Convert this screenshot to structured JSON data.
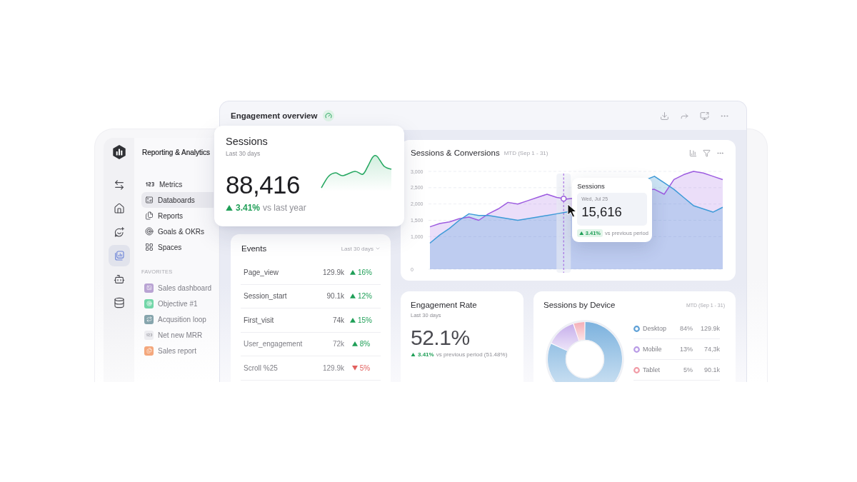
{
  "sidebar": {
    "rail": [
      {
        "kind": "swap",
        "selected": false
      },
      {
        "kind": "home",
        "selected": false
      },
      {
        "kind": "assistant",
        "selected": false
      },
      {
        "kind": "databoards",
        "selected": true
      },
      {
        "kind": "bot",
        "selected": false
      },
      {
        "kind": "data",
        "selected": false
      }
    ],
    "section_title": "Reporting & Analytics",
    "nav_items": [
      {
        "label": "Metrics",
        "kind": "metric",
        "selected": false
      },
      {
        "label": "Databoards",
        "kind": "databoard",
        "selected": true
      },
      {
        "label": "Reports",
        "kind": "report",
        "selected": false
      },
      {
        "label": "Goals & OKRs",
        "kind": "goal",
        "selected": false
      },
      {
        "label": "Spaces",
        "kind": "spaces",
        "selected": false
      }
    ],
    "favorites_heading": "FAVORITES",
    "favorites": [
      {
        "label": "Sales dashboard",
        "kind": "databoard",
        "color": "#b9a3d3"
      },
      {
        "label": "Objective #1",
        "kind": "goal",
        "color": "#72d6a8"
      },
      {
        "label": "Acqusition loop",
        "kind": "loop",
        "color": "#86a5ad"
      },
      {
        "label": "Net new MRR",
        "kind": "metric",
        "color": "#ececf0"
      },
      {
        "label": "Sales report",
        "kind": "report",
        "color": "#f4a77c"
      }
    ]
  },
  "dashboard": {
    "title": "Engagement overview",
    "sessions_card": {
      "title": "Sessions",
      "period": "Last 30 days",
      "value": "88,416",
      "change": "3.41%",
      "increase": true,
      "comparison": "vs last year"
    },
    "events": {
      "title": "Events",
      "period": "Last 30 days",
      "rows": [
        {
          "name": "Page_view",
          "value": "129.9k",
          "change": "16%",
          "increase": true
        },
        {
          "name": "Session_start",
          "value": "90.1k",
          "change": "12%",
          "increase": true
        },
        {
          "name": "First_visit",
          "value": "74k",
          "change": "15%",
          "increase": true
        },
        {
          "name": "User_engagement",
          "value": "72k",
          "change": "8%",
          "increase": true
        },
        {
          "name": "Scroll %25",
          "value": "129.9k",
          "change": "5%",
          "increase": false
        }
      ]
    },
    "sessions_conversions": {
      "title": "Sessions & Conversions",
      "period": "MTD (Sep 1 - 31)",
      "chart_data": {
        "type": "area",
        "categories": [
          null,
          null,
          null,
          null,
          null,
          null,
          null,
          null,
          null,
          null,
          null,
          null,
          null,
          null,
          null,
          null,
          null,
          null,
          null,
          null,
          null,
          null,
          null,
          null,
          null,
          null,
          null,
          null,
          null,
          null,
          null
        ],
        "ylim": [
          0,
          3000
        ],
        "yticks": [
          {
            "value": 0,
            "label": "0"
          },
          {
            "value": 1000,
            "label": "1,000"
          },
          {
            "value": 1500,
            "label": "1,500"
          },
          {
            "value": 2000,
            "label": "2,000"
          },
          {
            "value": 2500,
            "label": "2,500"
          },
          {
            "value": 3000,
            "label": "3,000"
          }
        ],
        "grid": true,
        "series": [
          {
            "color": "#9d5ce0",
            "values": [
              1300,
              1400,
              1450,
              1550,
              1600,
              1500,
              1700,
              1850,
              2050,
              2000,
              2100,
              2200,
              2300,
              2200,
              2150,
              null,
              null,
              null,
              null,
              null,
              null,
              null,
              null,
              2450,
              2300,
              2750,
              2900,
              3000,
              2950,
              2850,
              2750
            ]
          },
          {
            "color": "#3d9bd8",
            "values": [
              800,
              1050,
              1250,
              1500,
              1700,
              1650,
              1650,
              1600,
              1550,
              1500,
              1550,
              1600,
              1650,
              1700,
              1750,
              null,
              null,
              null,
              null,
              null,
              null,
              null,
              null,
              2850,
              2650,
              2450,
              2200,
              1950,
              1850,
              1750,
              1900
            ]
          }
        ]
      },
      "tooltip": {
        "title": "Sessions",
        "date": "Wed, Jul 25",
        "value": "15,616",
        "change": "3.41%",
        "increase": true,
        "comparison": "vs previous period"
      }
    },
    "engagement_rate": {
      "title": "Engagement Rate",
      "period": "Last 30 days",
      "value": "52.1%",
      "change": "3.41%",
      "increase": true,
      "comparison": "vs previous period (51.48%)"
    },
    "sessions_by_device": {
      "title": "Sessions by Device",
      "period": "MTD (Sep 1 - 31)",
      "chart_data": {
        "type": "donut",
        "categories": [
          "Desktop",
          "Mobile",
          "Tablet"
        ],
        "values": [
          82,
          13,
          5
        ],
        "legend": "right"
      },
      "legend": [
        {
          "share": "84%",
          "value": "129.9k",
          "color": "#5c9fd6"
        },
        {
          "share": "13%",
          "value": "74,3k",
          "color": "#b89ae6"
        },
        {
          "share": "5%",
          "value": "90.1k",
          "color": "#f19aa5"
        }
      ]
    }
  }
}
